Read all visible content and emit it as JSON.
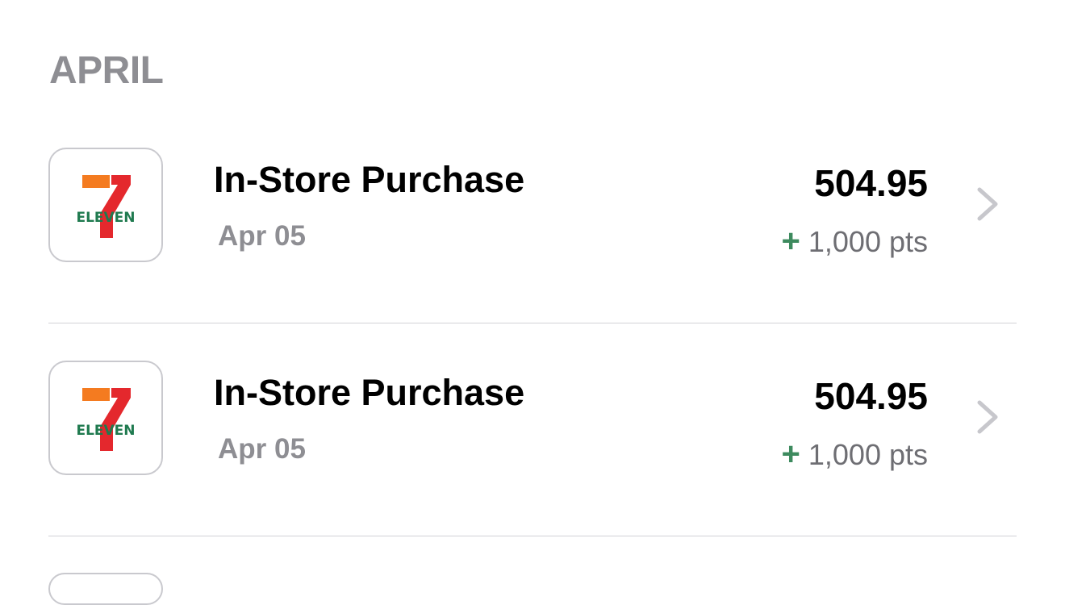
{
  "section": {
    "title": "APRIL"
  },
  "transactions": [
    {
      "logo_icon": "7-eleven-logo",
      "logo_text": "ELEVEN",
      "title": "In-Store Purchase",
      "date": "Apr 05",
      "amount": "504.95",
      "points_sign": "+",
      "points": "1,000 pts"
    },
    {
      "logo_icon": "7-eleven-logo",
      "logo_text": "ELEVEN",
      "title": "In-Store Purchase",
      "date": "Apr 05",
      "amount": "504.95",
      "points_sign": "+",
      "points": "1,000 pts"
    }
  ],
  "colors": {
    "brand_orange": "#f47b20",
    "brand_red": "#e4282d",
    "brand_green": "#1f7a4f",
    "points_plus": "#3d8a5e",
    "header_gray": "#8e8e93"
  }
}
